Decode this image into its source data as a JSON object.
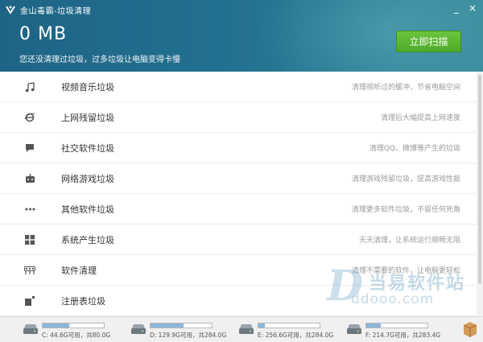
{
  "window": {
    "title": "金山毒霸-垃圾清理",
    "controls": [
      "_",
      "×"
    ]
  },
  "header": {
    "size": "0 MB",
    "subtitle": "您还没清理过垃圾，过多垃圾让电脑变得卡慢",
    "scan_button": "立即扫描"
  },
  "categories": [
    {
      "icon": "music-note-icon",
      "label": "视频音乐垃圾",
      "desc": "清理视听过的缓冲，节省电脑空间"
    },
    {
      "icon": "ie-browser-icon",
      "label": "上网残留垃圾",
      "desc": "清理后大幅提高上网速度"
    },
    {
      "icon": "chat-bubble-icon",
      "label": "社交软件垃圾",
      "desc": "清理QQ、微博等产生的垃圾"
    },
    {
      "icon": "gamepad-icon",
      "label": "网络游戏垃圾",
      "desc": "清理游戏残留垃圾，提高游戏性能"
    },
    {
      "icon": "more-dots-icon",
      "label": "其他软件垃圾",
      "desc": "清理更多软件垃圾，不留任何死角"
    },
    {
      "icon": "windows-logo-icon",
      "label": "系统产生垃圾",
      "desc": "天天清理，让系统运行顺畅无阻"
    },
    {
      "icon": "software-icon",
      "label": "软件清理",
      "desc": "清理不需要的软件，让电脑更轻松"
    },
    {
      "icon": "registry-icon",
      "label": "注册表垃圾",
      "desc": ""
    }
  ],
  "drives": [
    {
      "text": "C: 44.6G可用，共80.0G",
      "used": 0.44
    },
    {
      "text": "D: 129.9G可用，共284.0G",
      "used": 0.54
    },
    {
      "text": "E: 256.6G可用，共284.0G",
      "used": 0.1
    },
    {
      "text": "F: 214.7G可用，共283.4G",
      "used": 0.24
    }
  ],
  "watermark": {
    "brand": "当易软件站",
    "url": "ddooo.com"
  },
  "colors": {
    "header": "#22708f",
    "scan_button": "#5ab532",
    "drive_fill": "#8cb6d8"
  }
}
